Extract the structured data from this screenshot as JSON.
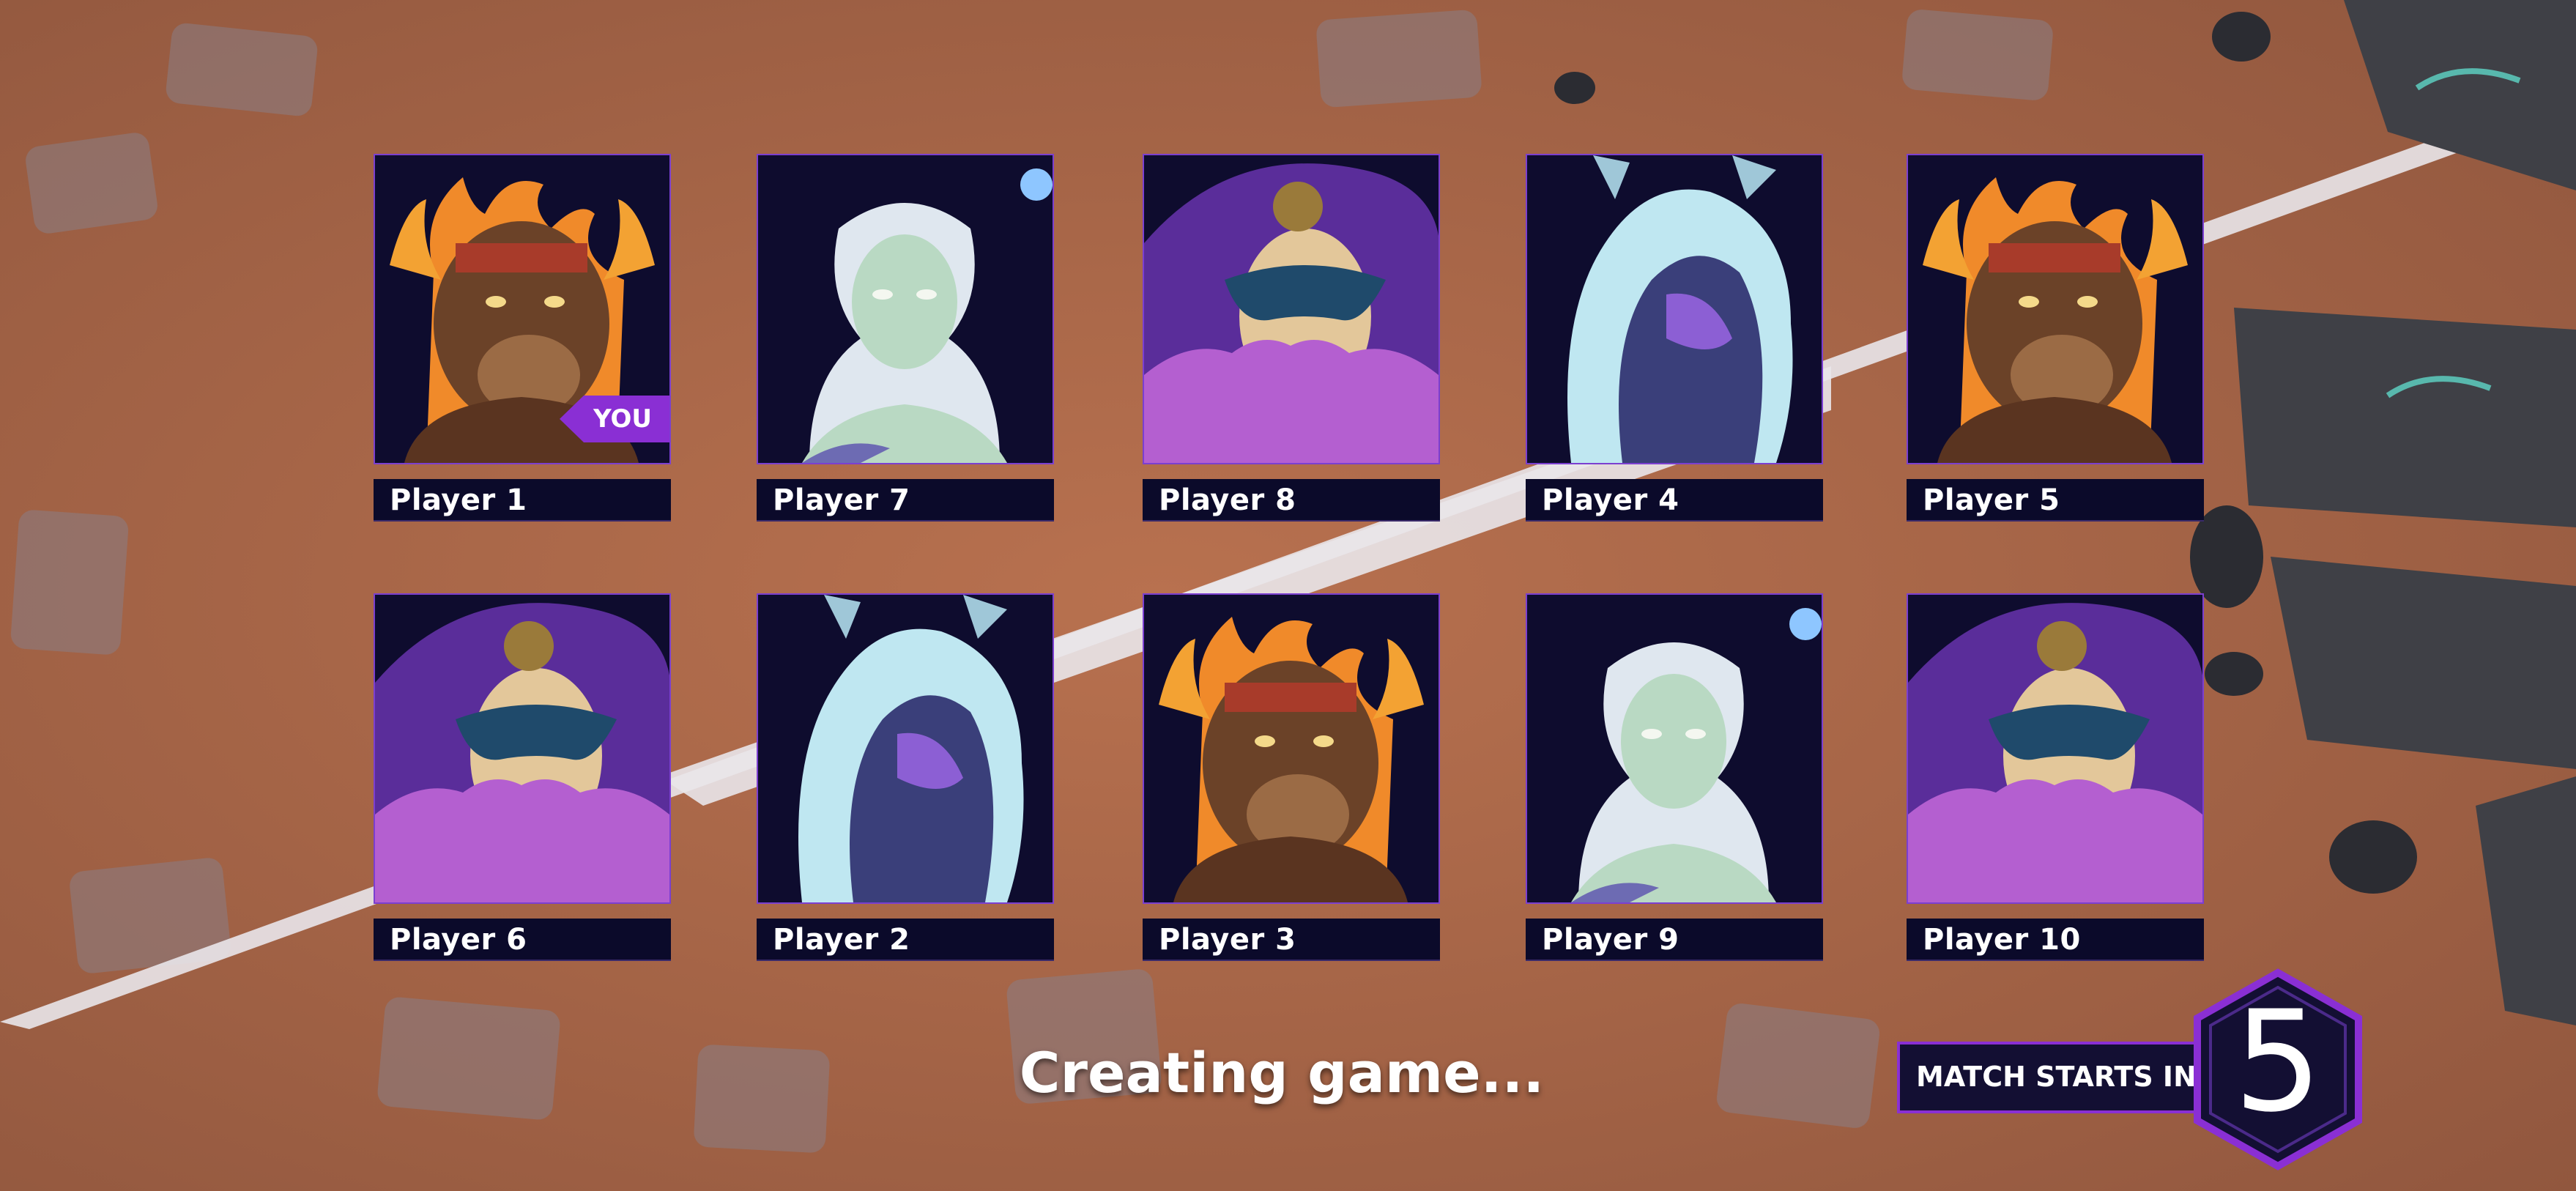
{
  "status_text": "Creating game...",
  "countdown": {
    "label": "MATCH STARTS IN",
    "seconds": "5"
  },
  "players": [
    {
      "name": "Player 1",
      "hero": "fire-bull",
      "badge": "YOU"
    },
    {
      "name": "Player 7",
      "hero": "ghost-lady"
    },
    {
      "name": "Player 8",
      "hero": "masked-jester"
    },
    {
      "name": "Player 4",
      "hero": "hooded-spirit"
    },
    {
      "name": "Player 5",
      "hero": "fire-bull"
    },
    {
      "name": "Player 6",
      "hero": "masked-jester"
    },
    {
      "name": "Player 2",
      "hero": "hooded-spirit"
    },
    {
      "name": "Player 3",
      "hero": "fire-bull"
    },
    {
      "name": "Player 9",
      "hero": "ghost-lady"
    },
    {
      "name": "Player 10",
      "hero": "masked-jester"
    }
  ],
  "colors": {
    "accent": "#8a2fd4",
    "plate": "#0b0a2a",
    "ground": "#a8674a"
  }
}
